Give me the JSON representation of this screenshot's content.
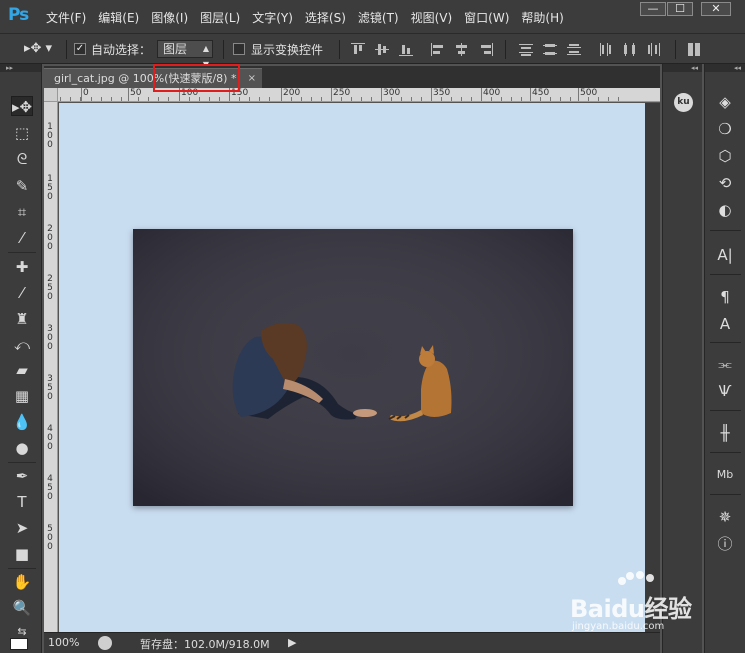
{
  "app": {
    "logo": "Ps"
  },
  "menu": [
    "文件(F)",
    "编辑(E)",
    "图像(I)",
    "图层(L)",
    "文字(Y)",
    "选择(S)",
    "滤镜(T)",
    "视图(V)",
    "窗口(W)",
    "帮助(H)"
  ],
  "window_controls": {
    "minimize": "—",
    "restore": "☐",
    "close": "✕"
  },
  "options": {
    "tool_glyph": "▸✥ ▾",
    "auto_select_label": "自动选择：",
    "auto_select_checked": true,
    "auto_select_target": "图层",
    "show_transform_label": "显示变换控件",
    "show_transform_checked": false
  },
  "document": {
    "tab_title": "girl_cat.jpg @ 100%(快速蒙版/8) *",
    "close": "×",
    "highlight_color": "#e01e1e",
    "canvas_color": "#c9ddf1"
  },
  "ruler": {
    "h_labels": [
      "50",
      "0",
      "50",
      "100",
      "150",
      "200",
      "250",
      "300",
      "350",
      "400",
      "450",
      "500"
    ],
    "v_labels": [
      "1",
      "0",
      "0",
      "1",
      "5",
      "0",
      "2",
      "0",
      "0",
      "2",
      "5",
      "0",
      "3",
      "0",
      "0",
      "3",
      "5",
      "0",
      "4",
      "0",
      "0",
      "4",
      "5",
      "0",
      "5",
      "0",
      "0"
    ]
  },
  "status": {
    "zoom": "100%",
    "scratch": "暂存盘：102.0M/918.0M",
    "arrow": "▶"
  },
  "panels": {
    "ku_badge": "ku"
  },
  "watermark": {
    "main": "Baidu经验",
    "sub": "jingyan.baidu.com"
  }
}
